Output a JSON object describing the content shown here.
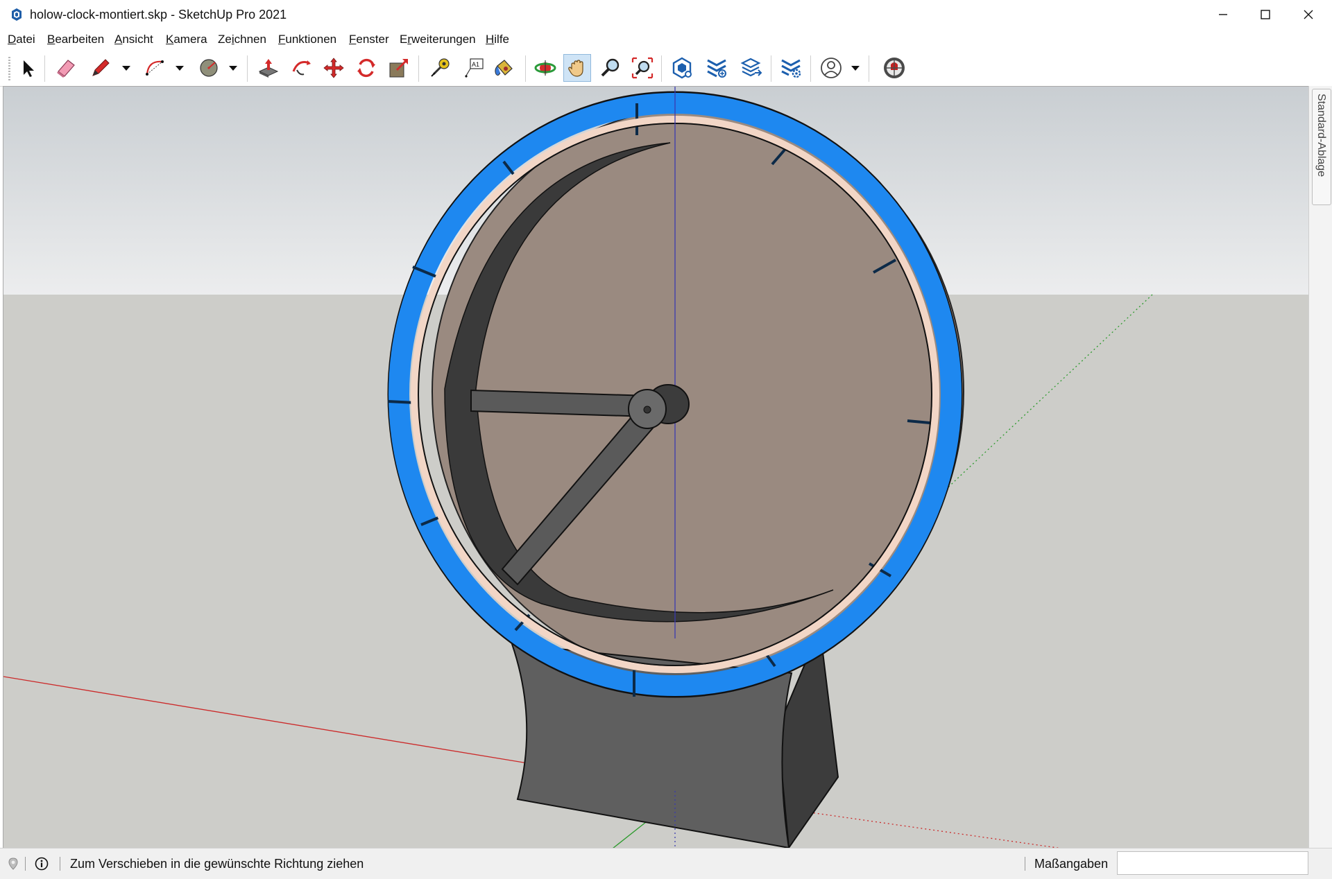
{
  "window": {
    "title": "holow-clock-montiert.skp - SketchUp Pro 2021",
    "controls": [
      "minimize",
      "maximize",
      "close"
    ]
  },
  "menu": [
    {
      "pre": "",
      "key": "D",
      "post": "atei"
    },
    {
      "pre": "",
      "key": "B",
      "post": "earbeiten"
    },
    {
      "pre": "",
      "key": "A",
      "post": "nsicht"
    },
    {
      "pre": "",
      "key": "K",
      "post": "amera"
    },
    {
      "pre": "Ze",
      "key": "i",
      "post": "chnen"
    },
    {
      "pre": "",
      "key": "F",
      "post": "unktionen"
    },
    {
      "pre": "",
      "key": "F",
      "post": "enster"
    },
    {
      "pre": "E",
      "key": "r",
      "post": "weiterungen"
    },
    {
      "pre": "",
      "key": "H",
      "post": "ilfe"
    }
  ],
  "toolbar": {
    "tools": [
      "select-icon",
      "eraser-icon",
      "pencil-icon",
      "arc-icon",
      "circle-icon",
      "push-pull-icon",
      "follow-me-icon",
      "move-icon",
      "rotate-icon",
      "scale-icon",
      "tape-measure-icon",
      "text-icon",
      "paint-bucket-icon",
      "orbit-icon",
      "pan-icon",
      "zoom-icon",
      "zoom-extents-icon",
      "warehouse-icon",
      "extension-warehouse-icon",
      "layout-icon",
      "extension-manager-icon",
      "account-icon",
      "ruby-icon"
    ],
    "active_tool": "pan-icon"
  },
  "tray": {
    "tab_label": "Standard-Ablage"
  },
  "status": {
    "message": "Zum Verschieben in die gewünschte Richtung ziehen",
    "measurements_label": "Maßangaben",
    "measurements_value": ""
  },
  "colors": {
    "accent_blue": "#1e88f0",
    "frame_rim": "#f2d6c6",
    "dark_body": "#3c3c3c",
    "sky": "#d9dcde",
    "ground": "#cdcdc9",
    "active_tool_bg": "#cfe4f6"
  }
}
